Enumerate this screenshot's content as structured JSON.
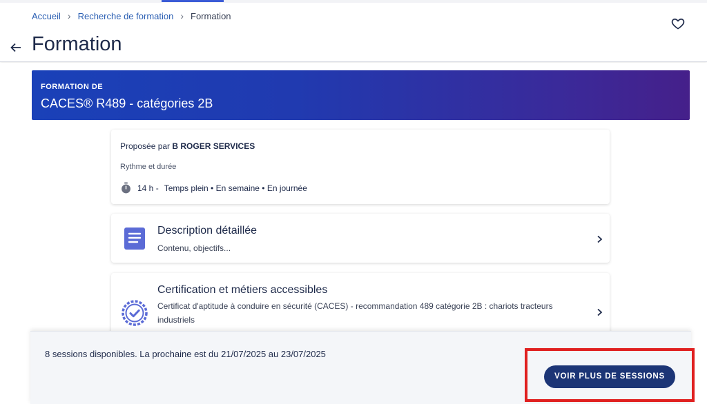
{
  "breadcrumb": {
    "home": "Accueil",
    "search": "Recherche de formation",
    "current": "Formation"
  },
  "header": {
    "title": "Formation"
  },
  "banner": {
    "kicker": "FORMATION DE",
    "title": "CACES® R489 - catégories 2B"
  },
  "overview": {
    "provider_prefix": "Proposée par",
    "provider_name": "B ROGER SERVICES",
    "rythme_label": "Rythme et durée",
    "duration": "14 h -",
    "schedule": "Temps plein • En semaine • En journée"
  },
  "description": {
    "title": "Description détaillée",
    "subtitle": "Contenu, objectifs..."
  },
  "certification": {
    "title": "Certification et métiers accessibles",
    "subtitle": "Certificat d'aptitude à conduire en sécurité (CACES) - recommandation 489 catégorie 2B : chariots tracteurs industriels"
  },
  "sessions": {
    "text": "8 sessions disponibles. La prochaine est du 21/07/2025 au 23/07/2025",
    "button": "VOIR PLUS DE SESSIONS"
  },
  "colors": {
    "accent": "#1c3576",
    "banner_start": "#1a41b8",
    "banner_end": "#45208a",
    "highlight": "#e02020",
    "link": "#2b5fb3"
  },
  "icons": [
    "heart-outline-icon",
    "arrow-left-icon",
    "timer-icon",
    "document-icon",
    "certified-badge-icon",
    "chevron-right-icon"
  ]
}
